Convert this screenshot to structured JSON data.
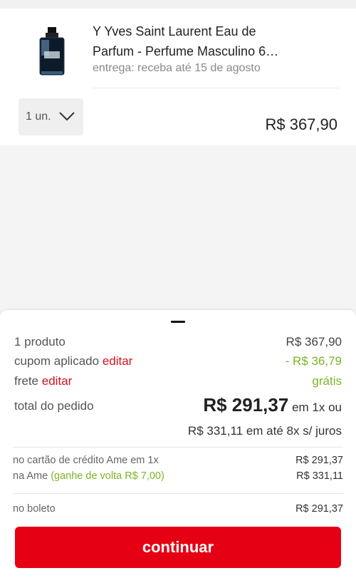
{
  "product": {
    "title_line1": "Y Yves Saint Laurent Eau de",
    "title_line2": "Parfum - Perfume Masculino 6…",
    "delivery": "entrega: receba até 15 de agosto",
    "quantity_label": "1 un.",
    "price": "R$ 367,90"
  },
  "summary": {
    "products_label": "1 produto",
    "products_value": "R$ 367,90",
    "coupon_label": "cupom aplicado",
    "coupon_edit": "editar",
    "coupon_value": "- R$ 36,79",
    "shipping_label": "frete",
    "shipping_edit": "editar",
    "shipping_value": "grátis",
    "total_label": "total do pedido",
    "total_value": "R$ 291,37",
    "total_suffix": "em 1x ou",
    "installment_text": "R$ 331,11 em até 8x s/ juros"
  },
  "payment_options": {
    "card_label": "no cartão de crédito Ame em 1x",
    "card_value": "R$ 291,37",
    "ame_label": "na Ame",
    "ame_cashback": "(ganhe de volta R$ 7,00)",
    "ame_value": "R$ 331,11",
    "boleto_label": "no boleto",
    "boleto_value": "R$ 291,37"
  },
  "actions": {
    "continue_label": "continuar"
  },
  "colors": {
    "accent_red": "#e60014",
    "link_red": "#d8101b",
    "discount_green": "#7bb527"
  }
}
